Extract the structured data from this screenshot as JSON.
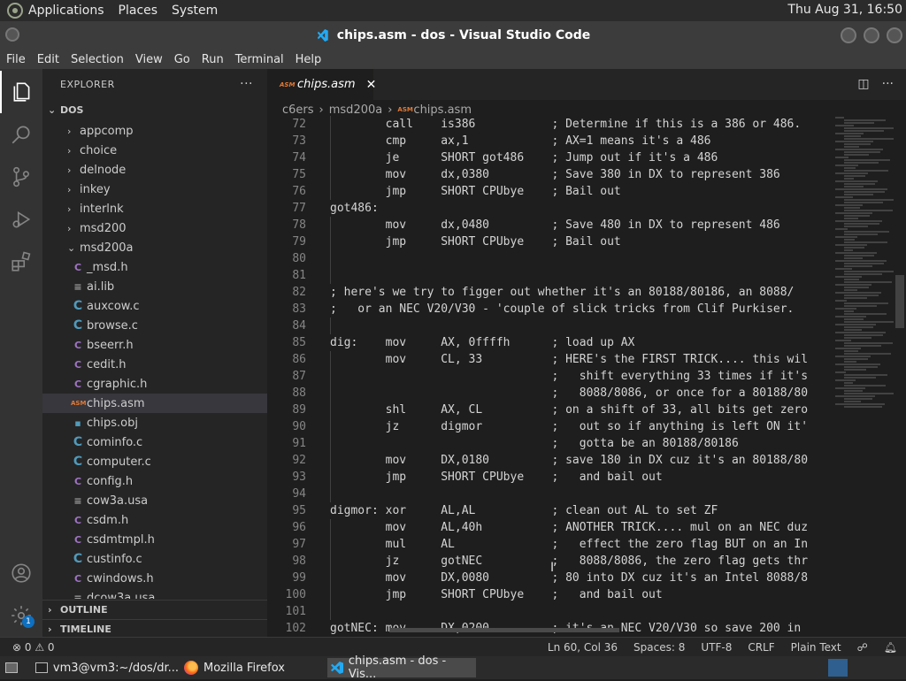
{
  "top_panel": {
    "menus": [
      "Applications",
      "Places",
      "System"
    ],
    "clock": "Thu Aug 31, 16:50"
  },
  "window": {
    "title": "chips.asm - dos - Visual Studio Code"
  },
  "menubar": [
    "File",
    "Edit",
    "Selection",
    "View",
    "Go",
    "Run",
    "Terminal",
    "Help"
  ],
  "sidebar": {
    "title": "EXPLORER",
    "more": "···",
    "root": "DOS",
    "folders": [
      "appcomp",
      "choice",
      "delnode",
      "inkey",
      "interlnk",
      "msd200"
    ],
    "open_folder": "msd200a",
    "files": [
      {
        "name": "_msd.h",
        "icon": "C"
      },
      {
        "name": "ai.lib",
        "icon": "≡"
      },
      {
        "name": "auxcow.c",
        "icon": "C"
      },
      {
        "name": "browse.c",
        "icon": "C"
      },
      {
        "name": "bseerr.h",
        "icon": "C"
      },
      {
        "name": "cedit.h",
        "icon": "C"
      },
      {
        "name": "cgraphic.h",
        "icon": "C"
      },
      {
        "name": "chips.asm",
        "icon": "ASM",
        "selected": true
      },
      {
        "name": "chips.obj",
        "icon": "▪"
      },
      {
        "name": "cominfo.c",
        "icon": "C"
      },
      {
        "name": "computer.c",
        "icon": "C"
      },
      {
        "name": "config.h",
        "icon": "C"
      },
      {
        "name": "cow3a.usa",
        "icon": "≡"
      },
      {
        "name": "csdm.h",
        "icon": "C"
      },
      {
        "name": "csdmtmpl.h",
        "icon": "C"
      },
      {
        "name": "custinfo.c",
        "icon": "C"
      },
      {
        "name": "cwindows.h",
        "icon": "C"
      },
      {
        "name": "dcow3a.usa",
        "icon": "≡"
      }
    ],
    "outline": "OUTLINE",
    "timeline": "TIMELINE"
  },
  "editor": {
    "tab_label": "chips.asm",
    "tab_icon": "ASM",
    "breadcrumb": [
      "c6ers",
      "msd200a",
      "chips.asm"
    ],
    "lines": [
      {
        "n": "72",
        "text": "        call    is386           ; Determine if this is a 386 or 486."
      },
      {
        "n": "73",
        "text": "        cmp     ax,1            ; AX=1 means it's a 486"
      },
      {
        "n": "74",
        "text": "        je      SHORT got486    ; Jump out if it's a 486"
      },
      {
        "n": "75",
        "text": "        mov     dx,0380         ; Save 380 in DX to represent 386"
      },
      {
        "n": "76",
        "text": "        jmp     SHORT CPUbye    ; Bail out"
      },
      {
        "n": "77",
        "text": "got486:"
      },
      {
        "n": "78",
        "text": "        mov     dx,0480         ; Save 480 in DX to represent 486"
      },
      {
        "n": "79",
        "text": "        jmp     SHORT CPUbye    ; Bail out"
      },
      {
        "n": "80",
        "text": ""
      },
      {
        "n": "81",
        "text": ""
      },
      {
        "n": "82",
        "text": "; here's we try to figger out whether it's an 80188/80186, an 8088/"
      },
      {
        "n": "83",
        "text": ";   or an NEC V20/V30 - 'couple of slick tricks from Clif Purkiser."
      },
      {
        "n": "84",
        "text": ""
      },
      {
        "n": "85",
        "text": "dig:    mov     AX, 0ffffh      ; load up AX"
      },
      {
        "n": "86",
        "text": "        mov     CL, 33          ; HERE's the FIRST TRICK.... this wil"
      },
      {
        "n": "87",
        "text": "                                ;   shift everything 33 times if it's"
      },
      {
        "n": "88",
        "text": "                                ;   8088/8086, or once for a 80188/80"
      },
      {
        "n": "89",
        "text": "        shl     AX, CL          ; on a shift of 33, all bits get zero"
      },
      {
        "n": "90",
        "text": "        jz      digmor          ;   out so if anything is left ON it'"
      },
      {
        "n": "91",
        "text": "                                ;   gotta be an 80188/80186"
      },
      {
        "n": "92",
        "text": "        mov     DX,0180         ; save 180 in DX cuz it's an 80188/80"
      },
      {
        "n": "93",
        "text": "        jmp     SHORT CPUbye    ;   and bail out"
      },
      {
        "n": "94",
        "text": ""
      },
      {
        "n": "95",
        "text": "digmor: xor     AL,AL           ; clean out AL to set ZF"
      },
      {
        "n": "96",
        "text": "        mov     AL,40h          ; ANOTHER TRICK.... mul on an NEC duz"
      },
      {
        "n": "97",
        "text": "        mul     AL              ;   effect the zero flag BUT on an In"
      },
      {
        "n": "98",
        "text": "        jz      gotNEC          ;   8088/8086, the zero flag gets thr"
      },
      {
        "n": "99",
        "text": "        mov     DX,0080         ; 80 into DX cuz it's an Intel 8088/8"
      },
      {
        "n": "100",
        "text": "        jmp     SHORT CPUbye    ;   and bail out"
      },
      {
        "n": "101",
        "text": ""
      },
      {
        "n": "102",
        "text": "gotNEC: mov     DX,0200         ; it's an NEC V20/V30 so save 200 in"
      }
    ]
  },
  "statusbar": {
    "errors": "⊗ 0 ⚠ 0",
    "position": "Ln 60, Col 36",
    "spaces": "Spaces: 8",
    "encoding": "UTF-8",
    "eol": "CRLF",
    "language": "Plain Text",
    "accounts_badge": "1"
  },
  "taskbar": {
    "tasks": [
      "vm3@vm3:~/dos/dr...",
      "Mozilla Firefox",
      "chips.asm - dos - Vis..."
    ]
  }
}
